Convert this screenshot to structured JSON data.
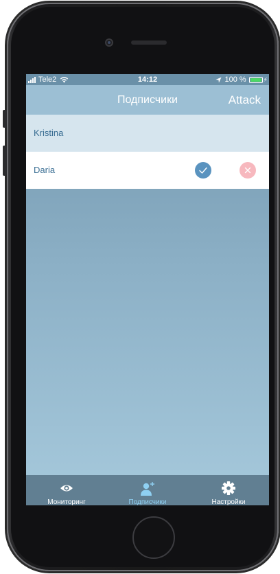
{
  "status_bar": {
    "carrier": "Tele2",
    "time": "14:12",
    "battery": "100 %",
    "battery_level": 1.0,
    "icons": [
      "signal-icon",
      "wifi-icon",
      "location-arrow-icon",
      "battery-icon",
      "charging-icon"
    ]
  },
  "nav": {
    "title": "Подписчики",
    "action_label": "Attack"
  },
  "subscribers": [
    {
      "name": "Kristina"
    },
    {
      "name": "Daria",
      "actions": [
        "approve-icon",
        "decline-icon"
      ]
    }
  ],
  "tabs": [
    {
      "label": "Мониторинг",
      "icon": "eye-icon",
      "active": false
    },
    {
      "label": "Подписчики",
      "icon": "add-user-icon",
      "active": true
    },
    {
      "label": "Настройки",
      "icon": "gear-icon",
      "active": false
    }
  ],
  "colors": {
    "nav_bar": "#9cbfd4",
    "tab_bar": "#617f92",
    "tab_active": "#8fd0f2",
    "approve": "#5a93bf",
    "decline": "#f7b8be",
    "row_text": "#3a6e93"
  }
}
